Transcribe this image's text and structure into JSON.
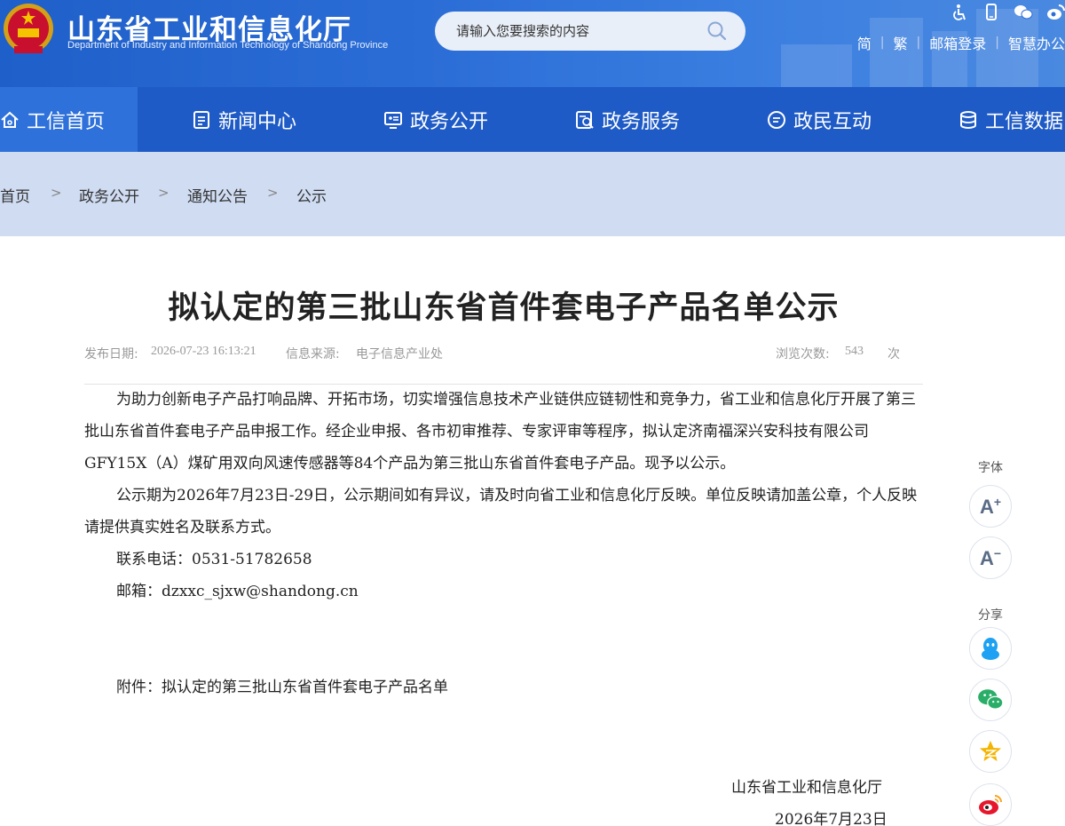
{
  "header": {
    "title_cn": "山东省工业和信息化厅",
    "title_en": "Department of Industry and Information Technology of Shandong Province",
    "search_placeholder": "请输入您要搜索的内容",
    "top_icons": [
      "accessibility-icon",
      "mobile-icon",
      "wechat-icon",
      "weibo-icon"
    ],
    "links": [
      "简",
      "繁",
      "邮箱登录",
      "智慧办公"
    ]
  },
  "nav": {
    "items": [
      {
        "label": "工信首页",
        "icon": "home-icon",
        "active": true
      },
      {
        "label": "新闻中心",
        "icon": "news-icon"
      },
      {
        "label": "政务公开",
        "icon": "monitor-icon"
      },
      {
        "label": "政务服务",
        "icon": "service-icon"
      },
      {
        "label": "政民互动",
        "icon": "chat-icon"
      },
      {
        "label": "工信数据",
        "icon": "database-icon"
      }
    ]
  },
  "breadcrumb": {
    "items": [
      "首页",
      "政务公开",
      "通知公告",
      "公示"
    ],
    "separator": ">"
  },
  "article": {
    "title": "拟认定的第三批山东省首件套电子产品名单公示",
    "publish_label": "发布日期:",
    "publish_date": "2026-07-23 16:13:21",
    "source_label": "信息来源:",
    "source": "电子信息产业处",
    "views_label": "浏览次数:",
    "views": "543",
    "views_unit": "次",
    "paragraphs": [
      "为助力创新电子产品打响品牌、开拓市场，切实增强信息技术产业链供应链韧性和竞争力，省工业和信息化厅开展了第三批山东省首件套电子产品申报工作。经企业申报、各市初审推荐、专家评审等程序，拟认定济南福深兴安科技有限公司GFY15X（A）煤矿用双向风速传感器等84个产品为第三批山东省首件套电子产品。现予以公示。",
      "公示期为2026年7月23日-29日，公示期间如有异议，请及时向省工业和信息化厅反映。单位反映请加盖公章，个人反映请提供真实姓名及联系方式。",
      "联系电话：0531-51782658",
      "邮箱：dzxxc_sjxw@shandong.cn"
    ],
    "attachment": "附件：拟认定的第三批山东省首件套电子产品名单",
    "signature_org": "山东省工业和信息化厅",
    "signature_date": "2026年7月23日"
  },
  "side_tools": {
    "font_label": "字体",
    "font_increase": "A",
    "font_decrease": "A",
    "share_label": "分享",
    "share_icons": [
      "qq-icon",
      "wechat-share-icon",
      "qzone-icon",
      "weibo-share-icon"
    ]
  },
  "colors": {
    "header_blue": "#2b6dd6",
    "nav_blue": "#1f5bc6",
    "breadcrumb_bg": "#cfdcf2",
    "qq": "#1ea1f2",
    "wechat": "#2aae67",
    "qzone": "#f5b400",
    "weibo": "#e6162d"
  }
}
